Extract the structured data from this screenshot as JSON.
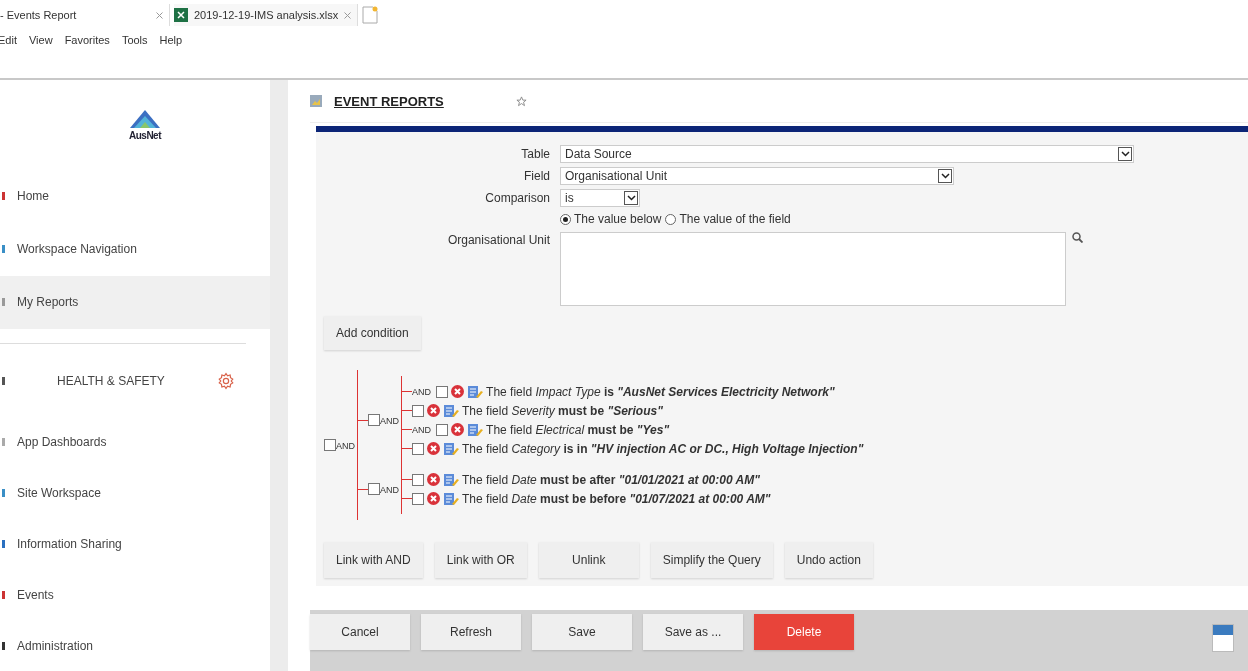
{
  "browser": {
    "tabs": [
      {
        "title": "- Events Report",
        "kind": "page",
        "selected": true
      },
      {
        "title": "2019-12-19-IMS analysis.xlsx",
        "kind": "excel",
        "selected": false
      }
    ],
    "menu": [
      "Edit",
      "View",
      "Favorites",
      "Tools",
      "Help"
    ]
  },
  "sidebar": {
    "logo": "AusNet",
    "items": [
      {
        "label": "Home",
        "selected": false
      },
      {
        "label": "Workspace Navigation",
        "selected": false
      },
      {
        "label": "My Reports",
        "selected": true
      }
    ],
    "section": "HEALTH & SAFETY",
    "section_items": [
      {
        "label": "App Dashboards",
        "selected": false
      },
      {
        "label": "Site Workspace",
        "selected": false
      },
      {
        "label": "Information Sharing",
        "selected": false
      },
      {
        "label": "Events",
        "selected": false
      },
      {
        "label": "Administration",
        "selected": false
      }
    ]
  },
  "page": {
    "title": "EVENT REPORTS",
    "favorite": false
  },
  "form": {
    "table": {
      "label": "Table",
      "value": "Data Source"
    },
    "field": {
      "label": "Field",
      "value": "Organisational Unit"
    },
    "comparison": {
      "label": "Comparison",
      "value": "is"
    },
    "value_mode": [
      {
        "label": "The value below",
        "selected": true
      },
      {
        "label": "The value of the field",
        "selected": false
      }
    ],
    "unit": {
      "label": "Organisational Unit"
    },
    "add_button": "Add condition"
  },
  "conditions": {
    "checked": false,
    "op": "AND",
    "children": [
      {
        "checked": false,
        "op": "AND",
        "children": [
          {
            "checked": false,
            "join": "AND",
            "prefix": "The field",
            "field": "Impact Type",
            "verb": "is",
            "value": "\"AusNet Services Electricity Network\""
          },
          {
            "checked": false,
            "prefix": "The field",
            "field": "Severity",
            "verb": "must be",
            "value": "\"Serious\""
          },
          {
            "checked": false,
            "join": "AND",
            "prefix": "The field",
            "field": "Electrical",
            "verb": "must be",
            "value": "\"Yes\""
          },
          {
            "checked": false,
            "prefix": "The field",
            "field": "Category",
            "verb": "is in",
            "value": "\"HV injection AC or DC., High Voltage Injection\""
          }
        ]
      },
      {
        "checked": false,
        "op": "AND",
        "children": [
          {
            "checked": false,
            "prefix": "The field",
            "field": "Date",
            "verb": "must be after",
            "value": "\"01/01/2021 at 00:00 AM\""
          },
          {
            "checked": false,
            "prefix": "The field",
            "field": "Date",
            "verb": "must be before",
            "value": "\"01/07/2021 at 00:00 AM\""
          }
        ]
      }
    ]
  },
  "query_buttons": [
    "Link with AND",
    "Link with OR",
    "Unlink",
    "Simplify the Query",
    "Undo action"
  ],
  "footer_buttons": [
    {
      "label": "Cancel",
      "kind": "normal"
    },
    {
      "label": "Refresh",
      "kind": "normal"
    },
    {
      "label": "Save",
      "kind": "normal"
    },
    {
      "label": "Save as ...",
      "kind": "normal"
    },
    {
      "label": "Delete",
      "kind": "danger"
    }
  ]
}
